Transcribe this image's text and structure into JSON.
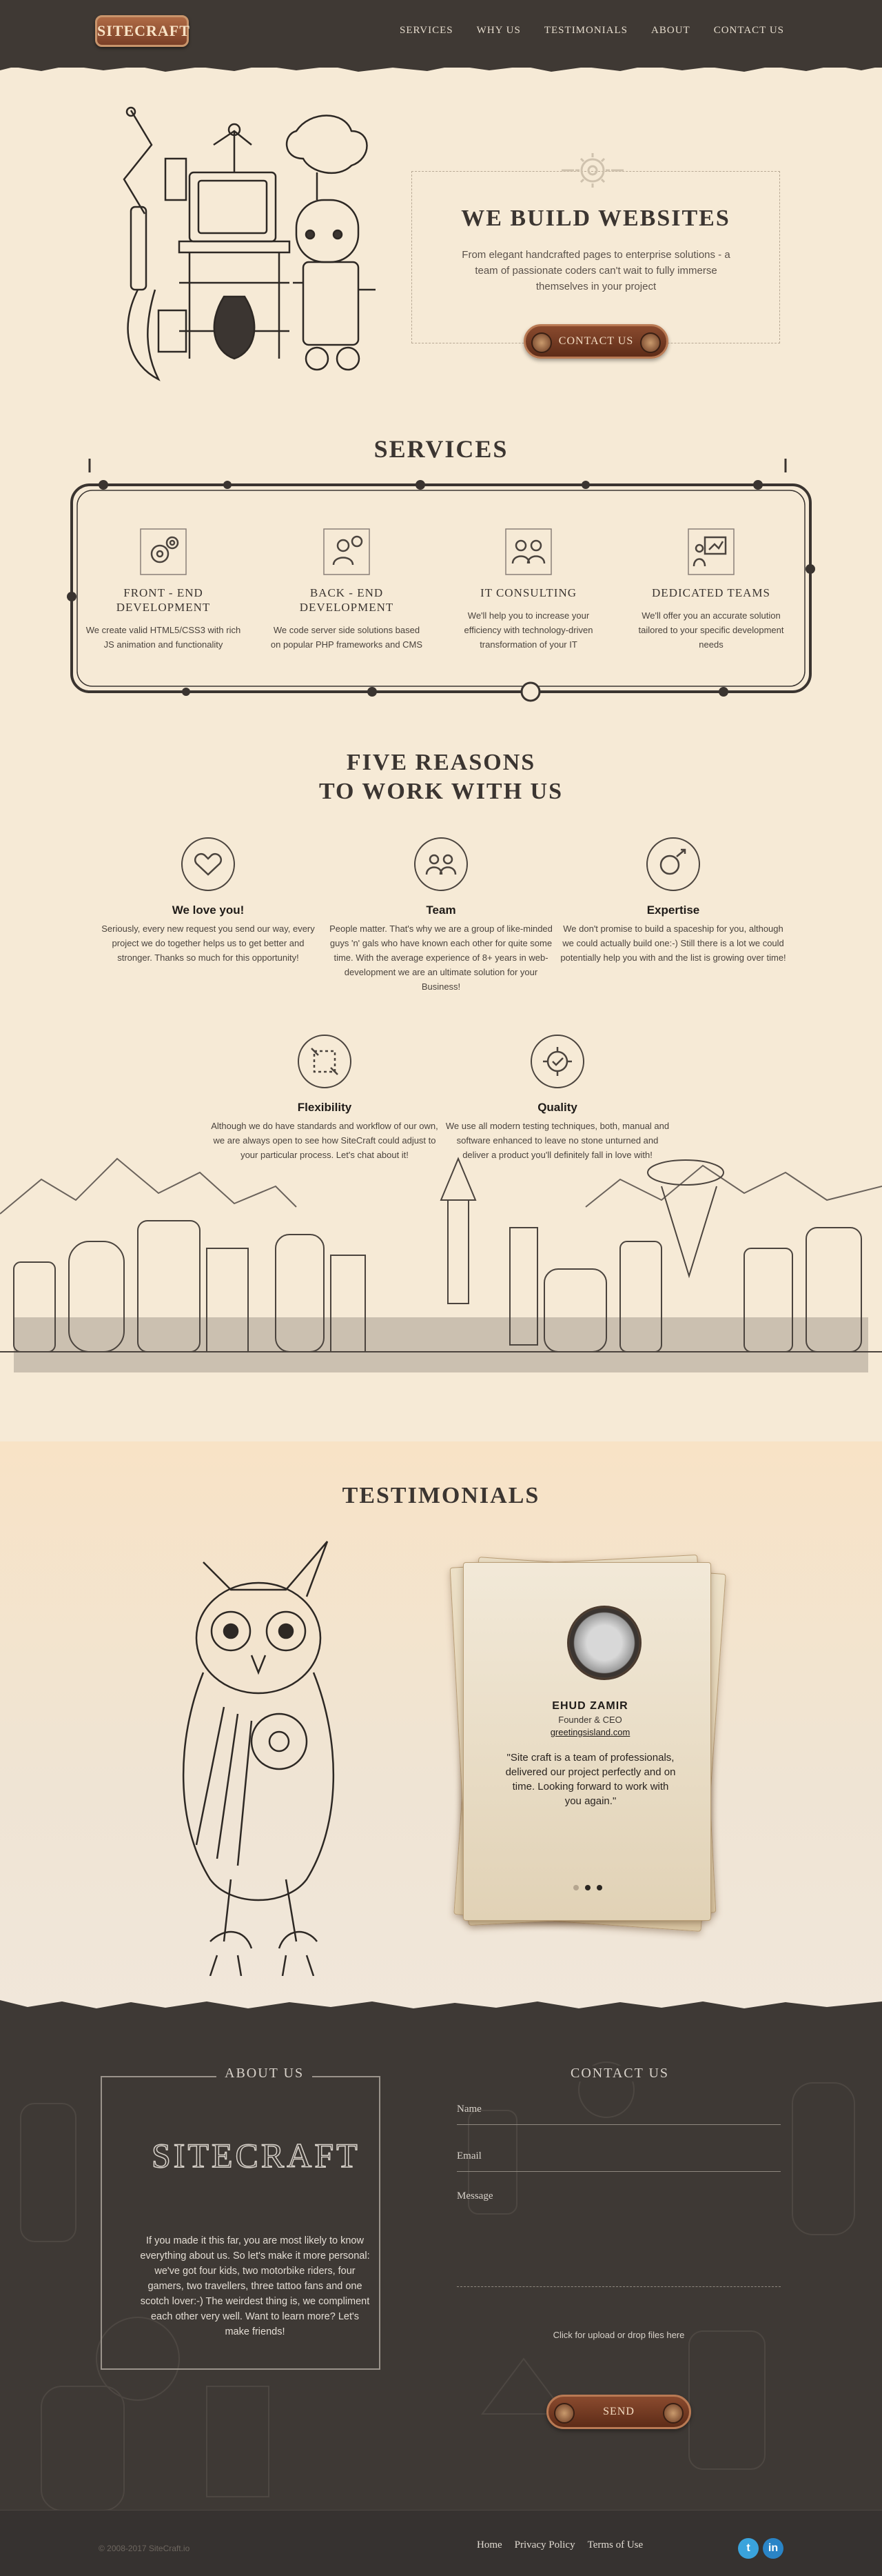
{
  "header": {
    "logo": "SITECRAFT",
    "nav": [
      "SERVICES",
      "WHY US",
      "TESTIMONIALS",
      "ABOUT",
      "CONTACT US"
    ]
  },
  "hero": {
    "title": "WE BUILD WEBSITES",
    "subtitle": "From elegant handcrafted pages to enterprise solutions - a team of passionate coders can't wait to fully immerse themselves in your project",
    "cta": "CONTACT US"
  },
  "services": {
    "title": "SERVICES",
    "items": [
      {
        "title": "FRONT - END DEVELOPMENT",
        "text": "We create valid HTML5/CSS3 with rich JS animation and functionality"
      },
      {
        "title": "BACK - END DEVELOPMENT",
        "text": "We code server side solutions based on popular PHP frameworks and CMS"
      },
      {
        "title": "IT CONSULTING",
        "text": "We'll help you to increase your efficiency with technology-driven transformation of your IT"
      },
      {
        "title": "DEDICATED TEAMS",
        "text": "We'll offer you an accurate solution tailored to your specific development needs"
      }
    ]
  },
  "reasons": {
    "title_line1": "FIVE REASONS",
    "title_line2": "TO WORK WITH US",
    "items": [
      {
        "title": "We love you!",
        "text": "Seriously, every new request you send our way, every project we do together helps us to get better and stronger. Thanks so much for this opportunity!"
      },
      {
        "title": "Team",
        "text": "People matter. That's why we are a group of like-minded guys 'n' gals who have known each other for quite some time. With the average experience of 8+ years in web-development we are an ultimate solution for your Business!"
      },
      {
        "title": "Expertise",
        "text": "We don't promise to build a spaceship for you, although we could actually build one:-) Still there is a lot we could potentially help you with and the list is growing over time!"
      },
      {
        "title": "Flexibility",
        "text": "Although we do have standards and workflow of our own, we are always open to see how SiteCraft could adjust to your particular process. Let's chat about it!"
      },
      {
        "title": "Quality",
        "text": "We use all modern testing techniques, both, manual and software enhanced to leave no stone unturned and deliver a product you'll definitely fall in love with!"
      }
    ]
  },
  "testimonials": {
    "title": "TESTIMONIALS",
    "name": "EHUD ZAMIR",
    "role": "Founder & CEO",
    "site": "greetingsisland.com",
    "quote": "\"Site craft is a team of professionals, delivered our project perfectly and on time. Looking forward to work with you again.\""
  },
  "footer": {
    "about_title": "ABOUT US",
    "logo": "SITECRAFT",
    "about_text": "If you made it this far, you are most likely to know everything about us. So let's make it more personal: we've got four kids, two motorbike riders, four gamers, two travellers, three tattoo fans and one scotch lover:-) The weirdest thing is, we compliment each other very well. Want to learn more? Let's make friends!",
    "contact_title": "CONTACT US",
    "name_label": "Name",
    "email_label": "Email",
    "message_label": "Message",
    "upload_text": "Click for upload or drop files here",
    "send": "SEND",
    "copyright": "© 2008-2017 SiteCraft.io",
    "links": [
      "Home",
      "Privacy Policy",
      "Terms of Use"
    ],
    "social": [
      "twitter-icon",
      "linkedin-icon"
    ],
    "social_colors": [
      "#3aa3dc",
      "#2a84c6"
    ]
  }
}
